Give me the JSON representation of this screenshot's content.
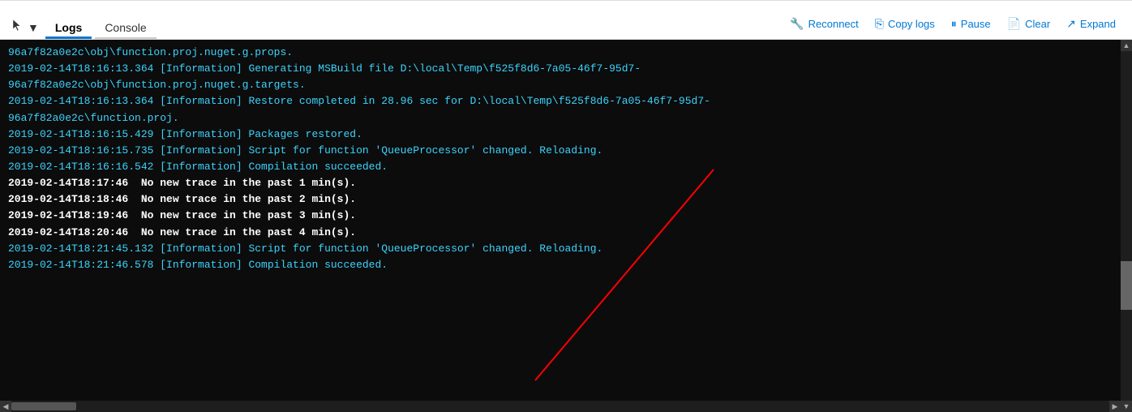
{
  "tabs": [
    {
      "id": "logs",
      "label": "Logs",
      "active": true
    },
    {
      "id": "console",
      "label": "Console",
      "active": false
    }
  ],
  "toolbar": {
    "reconnect_label": "Reconnect",
    "copy_logs_label": "Copy logs",
    "pause_label": "Pause",
    "clear_label": "Clear",
    "expand_label": "Expand"
  },
  "console": {
    "lines": [
      {
        "text": "96a7f82a0e2c\\obj\\function.proj.nuget.g.props.",
        "style": "blue"
      },
      {
        "text": "2019-02-14T18:16:13.364 [Information] Generating MSBuild file D:\\local\\Temp\\f525f8d6-7a05-46f7-95d7-",
        "style": "blue"
      },
      {
        "text": "96a7f82a0e2c\\obj\\function.proj.nuget.g.targets.",
        "style": "blue"
      },
      {
        "text": "2019-02-14T18:16:13.364 [Information] Restore completed in 28.96 sec for D:\\local\\Temp\\f525f8d6-7a05-46f7-95d7-",
        "style": "blue"
      },
      {
        "text": "96a7f82a0e2c\\function.proj.",
        "style": "blue"
      },
      {
        "text": "2019-02-14T18:16:15.429 [Information] Packages restored.",
        "style": "blue"
      },
      {
        "text": "2019-02-14T18:16:15.735 [Information] Script for function 'QueueProcessor' changed. Reloading.",
        "style": "blue"
      },
      {
        "text": "2019-02-14T18:16:16.542 [Information] Compilation succeeded.",
        "style": "blue"
      },
      {
        "text": "2019-02-14T18:17:46  No new trace in the past 1 min(s).",
        "style": "white-bold"
      },
      {
        "text": "2019-02-14T18:18:46  No new trace in the past 2 min(s).",
        "style": "white-bold"
      },
      {
        "text": "2019-02-14T18:19:46  No new trace in the past 3 min(s).",
        "style": "white-bold"
      },
      {
        "text": "2019-02-14T18:20:46  No new trace in the past 4 min(s).",
        "style": "white-bold"
      },
      {
        "text": "2019-02-14T18:21:45.132 [Information] Script for function 'QueueProcessor' changed. Reloading.",
        "style": "blue"
      },
      {
        "text": "2019-02-14T18:21:46.578 [Information] Compilation succeeded.",
        "style": "blue"
      }
    ]
  },
  "icons": {
    "reconnect": "🔧",
    "copy_logs": "📋",
    "pause": "⏸",
    "clear": "📄",
    "expand": "↗",
    "chevron_down": "▾"
  }
}
